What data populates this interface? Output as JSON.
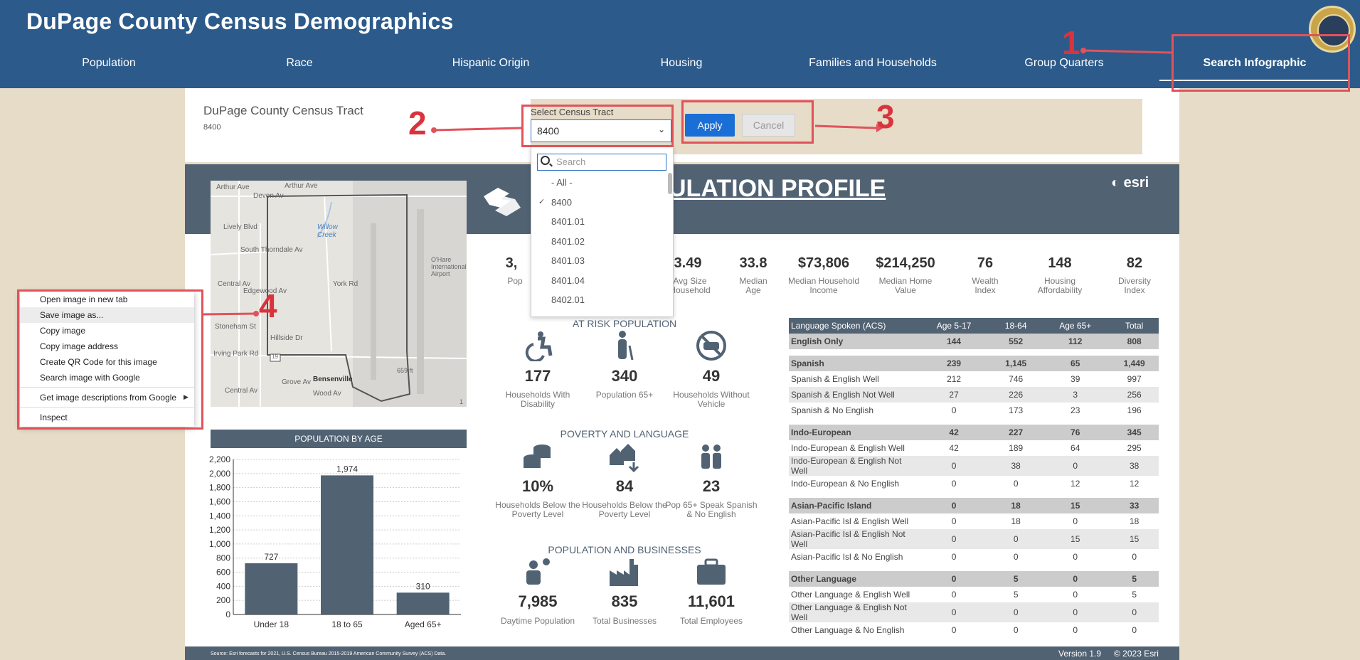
{
  "header": {
    "title": "DuPage County Census Demographics",
    "tabs": [
      {
        "label": "Population"
      },
      {
        "label": "Race"
      },
      {
        "label": "Hispanic Origin"
      },
      {
        "label": "Housing"
      },
      {
        "label": "Families and Households"
      },
      {
        "label": "Group Quarters"
      },
      {
        "label": "Search Infographic"
      }
    ],
    "active_tab": "Search Infographic",
    "seal_icon": "county-seal"
  },
  "tract": {
    "title": "DuPage County Census Tract",
    "value": "8400"
  },
  "filter": {
    "label": "Select Census Tract",
    "selected": "8400",
    "apply_label": "Apply",
    "cancel_label": "Cancel",
    "search_placeholder": "Search",
    "options": [
      "- All -",
      "8400",
      "8401.01",
      "8401.02",
      "8401.03",
      "8401.04",
      "8402.01"
    ],
    "checked_option": "8400"
  },
  "infographic": {
    "title": "ULATION PROFILE",
    "brand": "esri",
    "stats": [
      {
        "value": "3,",
        "label": "Pop"
      },
      {
        "value": "3.49",
        "label": "Avg Size Household"
      },
      {
        "value": "33.8",
        "label": "Median Age"
      },
      {
        "value": "$73,806",
        "label": "Median Household Income"
      },
      {
        "value": "$214,250",
        "label": "Median Home Value"
      },
      {
        "value": "76",
        "label": "Wealth Index"
      },
      {
        "value": "148",
        "label": "Housing Affordability"
      },
      {
        "value": "82",
        "label": "Diversity Index"
      }
    ],
    "at_risk": {
      "title": "AT RISK POPULATION",
      "items": [
        {
          "value": "177",
          "label": "Households With Disability",
          "icon": "wheelchair-icon"
        },
        {
          "value": "340",
          "label": "Population 65+",
          "icon": "elderly-icon"
        },
        {
          "value": "49",
          "label": "Households Without Vehicle",
          "icon": "no-car-icon"
        }
      ]
    },
    "poverty": {
      "title": "POVERTY AND LANGUAGE",
      "items": [
        {
          "value": "10%",
          "label": "Households Below the Poverty Level",
          "icon": "coins-icon"
        },
        {
          "value": "84",
          "label": "Households Below the Poverty Level",
          "icon": "houses-down-icon"
        },
        {
          "value": "23",
          "label": "Pop 65+ Speak Spanish & No English",
          "icon": "speakers-icon"
        }
      ]
    },
    "business": {
      "title": "POPULATION AND BUSINESSES",
      "items": [
        {
          "value": "7,985",
          "label": "Daytime Population",
          "icon": "worker-icon"
        },
        {
          "value": "835",
          "label": "Total Businesses",
          "icon": "factory-icon"
        },
        {
          "value": "11,601",
          "label": "Total Employees",
          "icon": "briefcase-icon"
        }
      ]
    },
    "language_table": {
      "headers": [
        "Language Spoken (ACS)",
        "Age 5-17",
        "18-64",
        "Age 65+",
        "Total"
      ],
      "rows": [
        {
          "cells": [
            "English Only",
            "144",
            "552",
            "112",
            "808"
          ],
          "kind": "grp"
        },
        {
          "cells": [
            "",
            "",
            "",
            "",
            ""
          ],
          "kind": "gap"
        },
        {
          "cells": [
            "Spanish",
            "239",
            "1,145",
            "65",
            "1,449"
          ],
          "kind": "grp"
        },
        {
          "cells": [
            "Spanish & English Well",
            "212",
            "746",
            "39",
            "997"
          ],
          "kind": ""
        },
        {
          "cells": [
            "Spanish & English Not Well",
            "27",
            "226",
            "3",
            "256"
          ],
          "kind": "alt"
        },
        {
          "cells": [
            "Spanish & No English",
            "0",
            "173",
            "23",
            "196"
          ],
          "kind": ""
        },
        {
          "cells": [
            "",
            "",
            "",
            "",
            ""
          ],
          "kind": "gap"
        },
        {
          "cells": [
            "Indo-European",
            "42",
            "227",
            "76",
            "345"
          ],
          "kind": "grp"
        },
        {
          "cells": [
            "Indo-European & English Well",
            "42",
            "189",
            "64",
            "295"
          ],
          "kind": ""
        },
        {
          "cells": [
            "Indo-European & English Not Well",
            "0",
            "38",
            "0",
            "38"
          ],
          "kind": "alt"
        },
        {
          "cells": [
            "Indo-European & No English",
            "0",
            "0",
            "12",
            "12"
          ],
          "kind": ""
        },
        {
          "cells": [
            "",
            "",
            "",
            "",
            ""
          ],
          "kind": "gap"
        },
        {
          "cells": [
            "Asian-Pacific Island",
            "0",
            "18",
            "15",
            "33"
          ],
          "kind": "grp"
        },
        {
          "cells": [
            "Asian-Pacific Isl & English Well",
            "0",
            "18",
            "0",
            "18"
          ],
          "kind": ""
        },
        {
          "cells": [
            "Asian-Pacific Isl & English Not Well",
            "0",
            "0",
            "15",
            "15"
          ],
          "kind": "alt"
        },
        {
          "cells": [
            "Asian-Pacific Isl & No English",
            "0",
            "0",
            "0",
            "0"
          ],
          "kind": ""
        },
        {
          "cells": [
            "",
            "",
            "",
            "",
            ""
          ],
          "kind": "gap"
        },
        {
          "cells": [
            "Other Language",
            "0",
            "5",
            "0",
            "5"
          ],
          "kind": "grp"
        },
        {
          "cells": [
            "Other Language & English Well",
            "0",
            "5",
            "0",
            "5"
          ],
          "kind": ""
        },
        {
          "cells": [
            "Other Language & English Not Well",
            "0",
            "0",
            "0",
            "0"
          ],
          "kind": "alt"
        },
        {
          "cells": [
            "Other Language & No English",
            "0",
            "0",
            "0",
            "0"
          ],
          "kind": ""
        }
      ]
    },
    "map_labels": [
      "Arthur Ave",
      "Arthur Ave",
      "Devon Av",
      "Willow Creek",
      "South Thorndale Av",
      "O'Hare International Airport",
      "York Rd",
      "Central Av",
      "Edgewood Av",
      "Lively Blvd",
      "Stoneham St",
      "Hillside Dr",
      "Irving Park Rd",
      "Grove Av",
      "Bensenville",
      "Wood Av",
      "Central Av",
      "19",
      "659 ft",
      "1"
    ],
    "footer": {
      "source": "Source: Esri forecasts for 2021, U.S. Census Bureau 2015-2019 American Community Survey (ACS) Data.",
      "version": "Version 1.9",
      "copyright": "© 2023 Esri"
    }
  },
  "chart_data": {
    "type": "bar",
    "title": "POPULATION BY AGE",
    "categories": [
      "Under 18",
      "18 to 65",
      "Aged 65+"
    ],
    "values": [
      727,
      1974,
      310
    ],
    "ylim": [
      0,
      2200
    ],
    "yticks": [
      "0",
      "200",
      "400",
      "600",
      "800",
      "1,000",
      "1,200",
      "1,400",
      "1,600",
      "1,800",
      "2,000",
      "2,200"
    ],
    "value_labels": [
      "727",
      "1,974",
      "310"
    ],
    "bar_color": "#516273",
    "grid": true
  },
  "context_menu": {
    "items": [
      {
        "label": "Open image in new tab"
      },
      {
        "label": "Save image as..."
      },
      {
        "label": "Copy image"
      },
      {
        "label": "Copy image address"
      },
      {
        "label": "Create QR Code for this image"
      },
      {
        "label": "Search image with Google"
      },
      {
        "label": "Get image descriptions from Google"
      },
      {
        "label": "Inspect"
      }
    ],
    "highlighted": "Save image as..."
  },
  "annotations": {
    "numbers": [
      "1",
      "2",
      "3",
      "4"
    ],
    "color": "#e0535b"
  },
  "colors": {
    "header": "#2c5a8a",
    "infographic": "#516273",
    "apply": "#1a6fd6",
    "background": "#e6dcc8"
  }
}
